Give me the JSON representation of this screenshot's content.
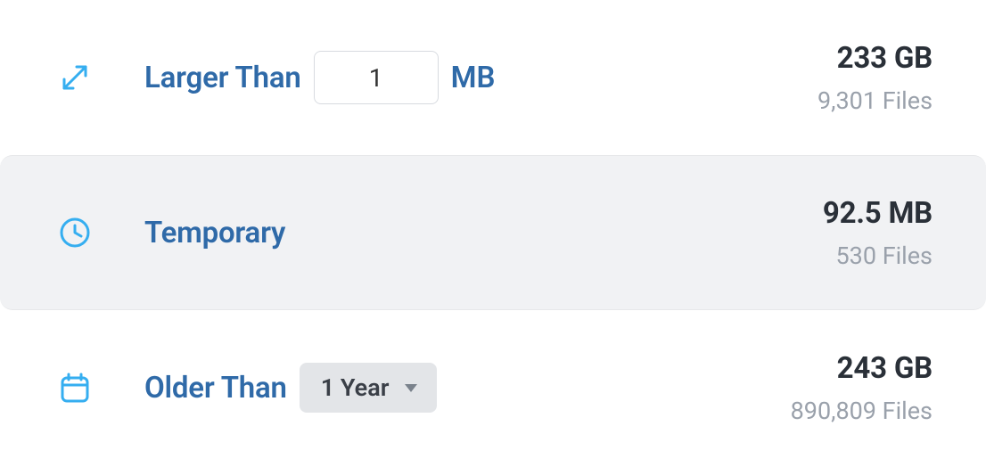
{
  "rows": {
    "larger": {
      "label": "Larger Than",
      "value": "1",
      "unit": "MB",
      "size": "233 GB",
      "files": "9,301 Files"
    },
    "temporary": {
      "label": "Temporary",
      "size": "92.5 MB",
      "files": "530 Files"
    },
    "older": {
      "label": "Older Than",
      "selected": "1 Year",
      "size": "243 GB",
      "files": "890,809 Files"
    }
  }
}
